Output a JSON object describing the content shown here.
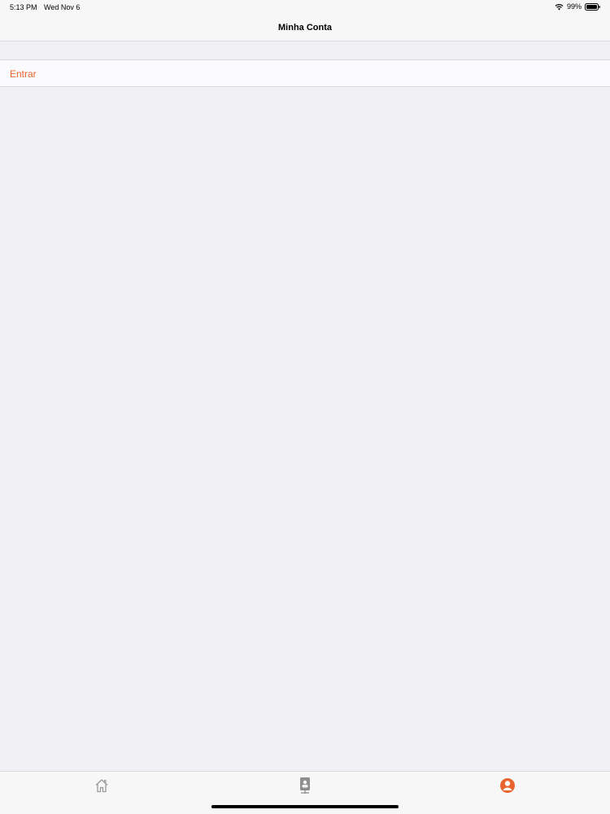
{
  "status_bar": {
    "time": "5:13 PM",
    "date": "Wed Nov 6",
    "battery": "99%",
    "wifi_icon": "wifi-icon",
    "battery_icon": "battery-icon"
  },
  "nav": {
    "title": "Minha Conta"
  },
  "login": {
    "label": "Entrar"
  },
  "tab_bar": {
    "tabs": [
      {
        "icon": "home-icon",
        "selected": false
      },
      {
        "icon": "device-icon",
        "selected": false
      },
      {
        "icon": "account-icon",
        "selected": true
      }
    ]
  },
  "colors": {
    "accent": "#e8642c",
    "background": "#efeff4",
    "bar": "#f7f7f7"
  }
}
